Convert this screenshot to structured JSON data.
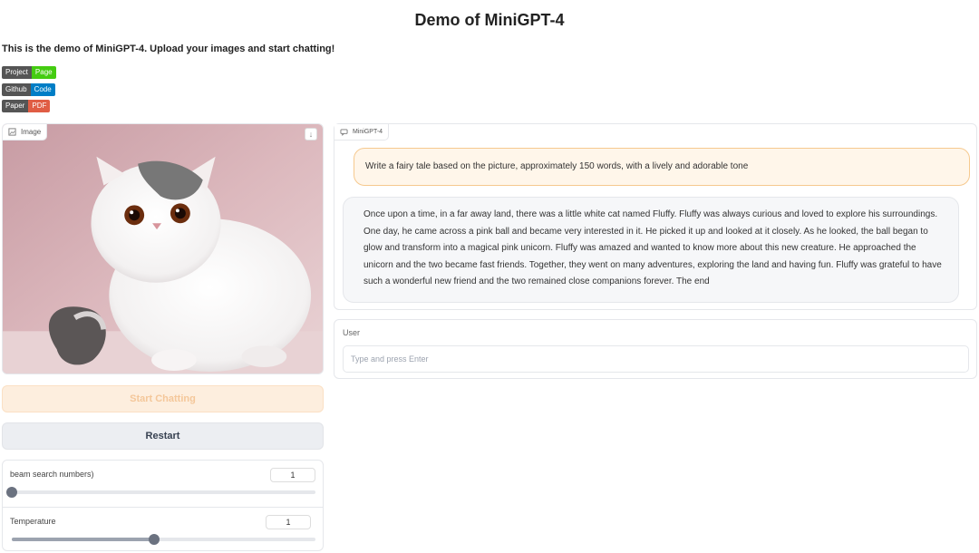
{
  "page": {
    "title": "Demo of MiniGPT-4",
    "intro": "This is the demo of MiniGPT-4. Upload your images and start chatting!"
  },
  "badges": [
    {
      "left": "Project",
      "right": "Page",
      "color": "#44cc11"
    },
    {
      "left": "Github",
      "right": "Code",
      "color": "#007ec6"
    },
    {
      "left": "Paper",
      "right": "PDF",
      "color": "#e05d44"
    }
  ],
  "image_panel": {
    "label": "Image",
    "label_icon": "image-icon",
    "download_icon": "download-icon"
  },
  "buttons": {
    "start": "Start Chatting",
    "restart": "Restart"
  },
  "sliders": [
    {
      "label": "beam search numbers)",
      "value": "1",
      "fraction": 0.0
    },
    {
      "label": "Temperature",
      "value": "1",
      "fraction": 0.47
    }
  ],
  "chat": {
    "label": "MiniGPT-4",
    "label_icon": "chatbot-icon",
    "user_message": "Write a fairy tale based on the picture, approximately 150 words, with a lively and adorable tone",
    "bot_message": "Once upon a time, in a far away land, there was a little white cat named Fluffy. Fluffy was always curious and loved to explore his surroundings. One day, he came across a pink ball and became very interested in it. He picked it up and looked at it closely. As he looked, the ball began to glow and transform into a magical pink unicorn. Fluffy was amazed and wanted to know more about this new creature. He approached the unicorn and the two became fast friends. Together, they went on many adventures, exploring the land and having fun. Fluffy was grateful to have such a wonderful new friend and the two remained close companions forever. The end"
  },
  "user_input": {
    "label": "User",
    "placeholder": "Type and press Enter",
    "value": ""
  }
}
